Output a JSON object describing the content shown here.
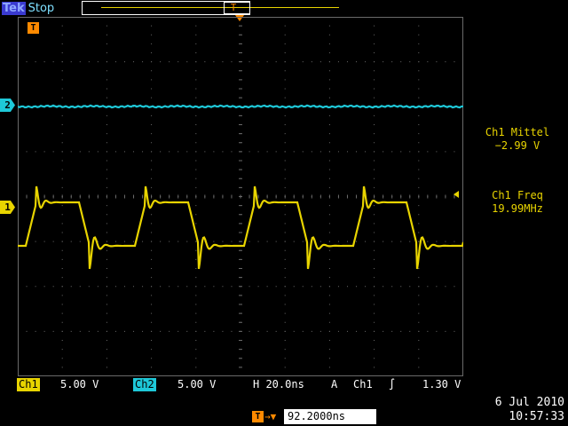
{
  "header": {
    "brand": "Tek",
    "status": "Stop"
  },
  "markers": {
    "trigger": "T",
    "ch2": "2",
    "ch1": "1"
  },
  "measurements": [
    {
      "label": "Ch1 Mittel",
      "value": "−2.99 V"
    },
    {
      "label": "Ch1 Freq",
      "value": "19.99MHz"
    }
  ],
  "status_bar": {
    "ch1_label": "Ch1",
    "ch1_scale": "5.00 V",
    "ch2_label": "Ch2",
    "ch2_scale": "5.00 V",
    "horizontal": "H 20.0ns",
    "trigger_mode": "A",
    "trigger_source": "Ch1",
    "trigger_slope": "∫",
    "trigger_level": "1.30 V"
  },
  "trigger_position": {
    "icon": "T",
    "arrow": "→▼",
    "value": "92.2000ns"
  },
  "datetime": {
    "date": "6 Jul  2010",
    "time": "10:57:33"
  },
  "colors": {
    "ch1": "#e8d400",
    "ch2": "#1ec8d8",
    "trigger": "#ff8a00",
    "grid": "#6a6a6a"
  },
  "chart_data": {
    "type": "line",
    "series": [
      {
        "channel": "Ch1",
        "waveform": "square",
        "frequency_mhz": 19.99,
        "mean_v": -2.99
      },
      {
        "channel": "Ch2",
        "waveform": "flat"
      }
    ]
  }
}
